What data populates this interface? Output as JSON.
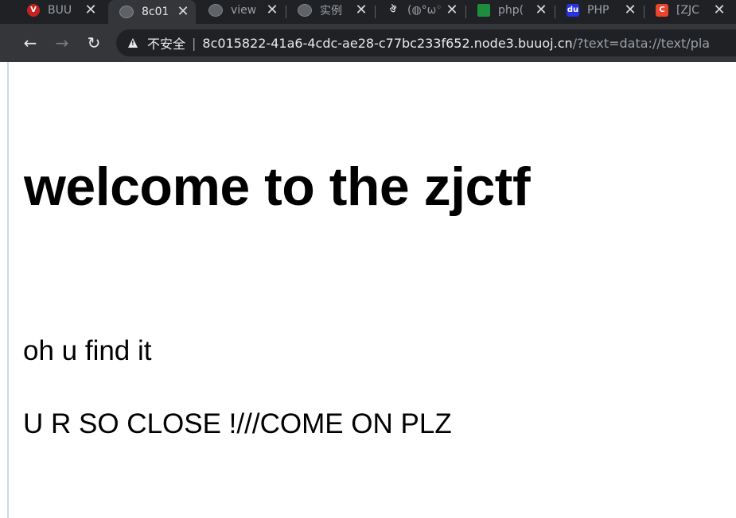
{
  "browser": {
    "tabs": [
      {
        "title": "BUU",
        "icon": "buu-favicon-icon",
        "active": false
      },
      {
        "title": "8c01",
        "icon": "globe-icon",
        "active": true
      },
      {
        "title": "view",
        "icon": "globe-icon",
        "active": false
      },
      {
        "title": "实例",
        "icon": "globe-icon",
        "active": false
      },
      {
        "title": "(◍°ω°",
        "icon": "swirl-favicon-icon",
        "active": false
      },
      {
        "title": "php(",
        "icon": "green-bar-favicon-icon",
        "active": false
      },
      {
        "title": "PHP",
        "icon": "baidu-paw-icon",
        "active": false
      },
      {
        "title": "[ZJC",
        "icon": "csdn-c-icon",
        "active": false
      }
    ],
    "close_glyph": "✕",
    "nav": {
      "back": "←",
      "forward": "→",
      "reload": "↻"
    },
    "address": {
      "security_label": "不安全",
      "divider": "|",
      "host": "8c015822-41a6-4cdc-ae28-c77bc233f652.node3.buuoj.cn",
      "path": "/?text=data://text/pla"
    }
  },
  "page": {
    "heading": "welcome to the zjctf",
    "line1": "oh u find it",
    "line2": "U R SO CLOSE !///COME ON PLZ"
  }
}
